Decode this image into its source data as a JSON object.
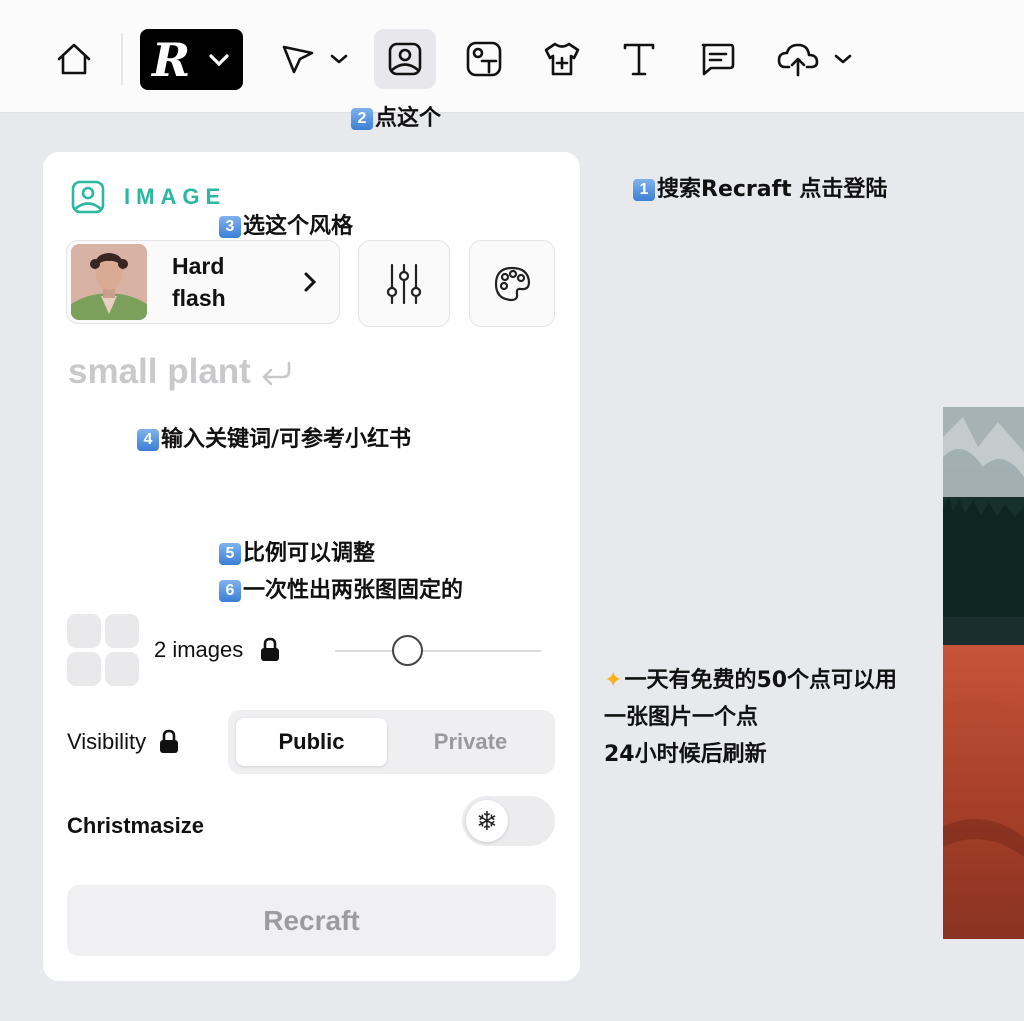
{
  "toolbar": {
    "tools": [
      "home-icon",
      "recraft-logo",
      "pointer-icon",
      "image-icon",
      "text-image-icon",
      "mockup-icon",
      "text-icon",
      "comment-icon",
      "upload-icon"
    ],
    "logo_letter": "R",
    "active_tool": "image-icon"
  },
  "annotations": {
    "step1_num": "1",
    "step1": "搜索Recraft 点击登陆",
    "step2_num": "2",
    "step2": "点这个",
    "step3_num": "3",
    "step3": "选这个风格",
    "step4_num": "4",
    "step4": "输入关键词/可参考小红书",
    "step5_num": "5",
    "step5": "比例可以调整",
    "step6_num": "6",
    "step6": "一次性出两张图固定的",
    "tip_line1": "一天有免费的50个点可以用",
    "tip_line2": "一张图片一个点",
    "tip_line3": "24小时候后刷新"
  },
  "panel": {
    "section_title": "IMAGE",
    "style_name_line1": "Hard",
    "style_name_line2": "flash",
    "prompt_placeholder": "small plant",
    "image_count": "2 images",
    "visibility_label": "Visibility",
    "visibility_options": [
      "Public",
      "Private"
    ],
    "visibility_selected": "Public",
    "christmasize_label": "Christmasize",
    "christmasize_on": false,
    "submit_label": "Recraft",
    "slider_value": 0.35
  },
  "colors": {
    "accent": "#2bb8a2",
    "background": "#e8e9ed",
    "panel": "#ffffff"
  }
}
